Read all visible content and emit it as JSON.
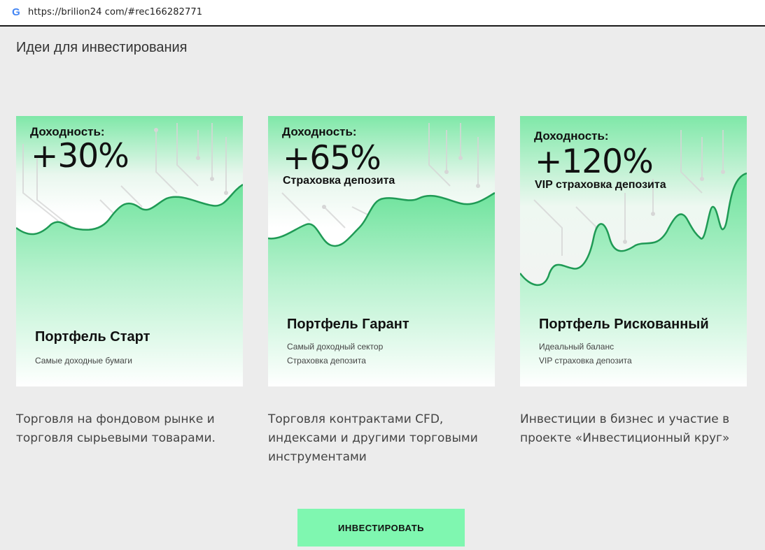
{
  "browser": {
    "url": "https://brilion24 com/#rec166282771",
    "favicon_letter": "G"
  },
  "section_title": "Идеи для инвестирования",
  "cards": [
    {
      "yield_label": "Доходность:",
      "yield_value": "+30%",
      "subtitle": "",
      "name": "Портфель Старт",
      "features": [
        "Самые доходные бумаги"
      ],
      "caption": [
        "Торговля на фондовом рынке и",
        "торговля сырьевыми товарами."
      ]
    },
    {
      "yield_label": "Доходность:",
      "yield_value": "+65%",
      "subtitle": "Страховка депозита",
      "name": "Портфель Гарант",
      "features": [
        "Самый доходный сектор",
        "Страховка депозита"
      ],
      "caption": [
        "Торговля контрактами CFD,",
        "индексами и другими торговыми",
        "инструментами"
      ]
    },
    {
      "yield_label": "Доходность:",
      "yield_value": "+120%",
      "subtitle": "VIP страховка депозита",
      "name": "Портфель Рискованный",
      "features": [
        "Идеальный баланс",
        "VIP страховка депозита"
      ],
      "caption": [
        "Инвестиции в бизнес и участие в",
        "проекте «Инвестиционный круг»"
      ]
    }
  ],
  "invest_button": "ИНВЕСТИРОВАТЬ",
  "colors": {
    "accent_green": "#7ff7b0",
    "line_green": "#1f9a55",
    "page_bg": "#ececec"
  }
}
